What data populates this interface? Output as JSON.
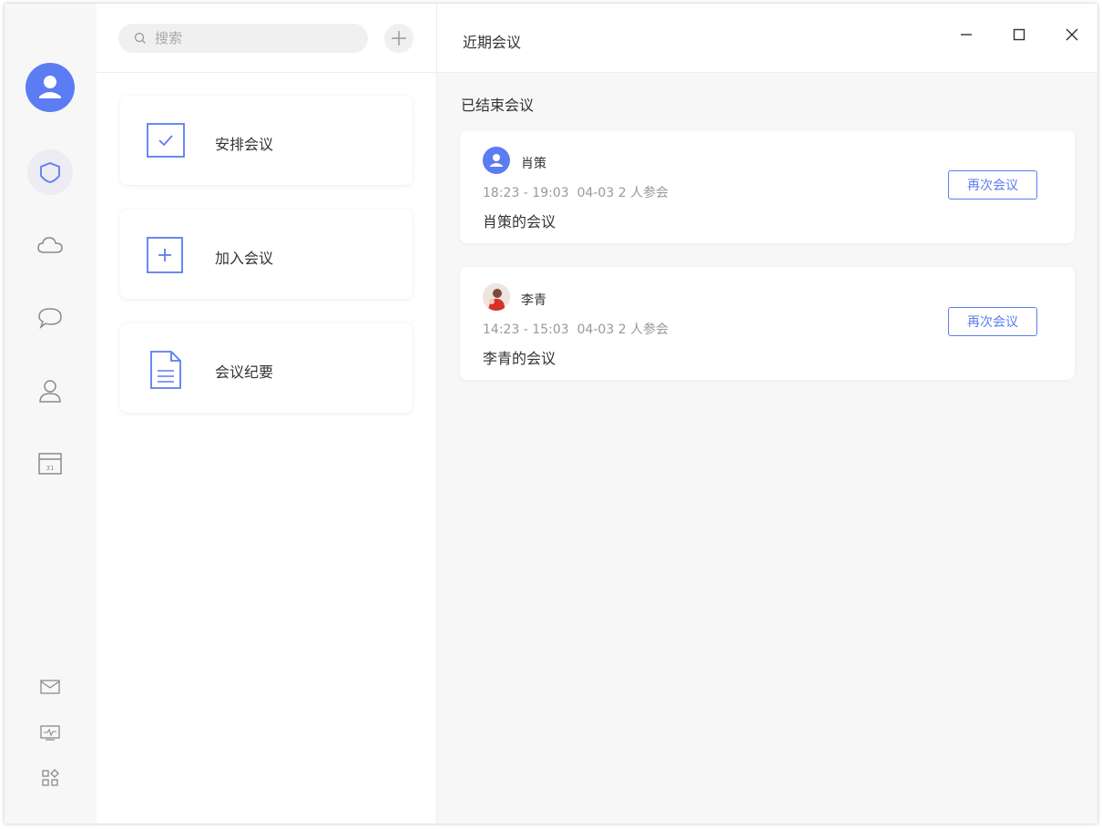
{
  "search": {
    "placeholder": "搜索"
  },
  "actions": [
    {
      "label": "安排会议",
      "icon": "check-square-icon"
    },
    {
      "label": "加入会议",
      "icon": "plus-square-icon"
    },
    {
      "label": "会议纪要",
      "icon": "document-icon"
    }
  ],
  "header": {
    "title": "近期会议"
  },
  "section": {
    "title": "已结束会议"
  },
  "meetings": [
    {
      "host": "肖策",
      "time": "18:23 - 19:03",
      "date": "04-03",
      "participants": "2 人参会",
      "title": "肖策的会议",
      "button": "再次会议"
    },
    {
      "host": "李青",
      "time": "14:23 - 15:03",
      "date": "04-03",
      "participants": "2 人参会",
      "title": "李青的会议",
      "button": "再次会议"
    }
  ],
  "rail": {
    "items": [
      "meeting-icon",
      "cloud-icon",
      "chat-icon",
      "contacts-icon",
      "calendar-icon"
    ],
    "calendar_day": "31",
    "bottom": [
      "mail-icon",
      "monitor-icon",
      "apps-icon"
    ]
  },
  "colors": {
    "accent": "#5b7cf2",
    "panel_bg": "#f7f7f7",
    "muted": "#999999"
  }
}
